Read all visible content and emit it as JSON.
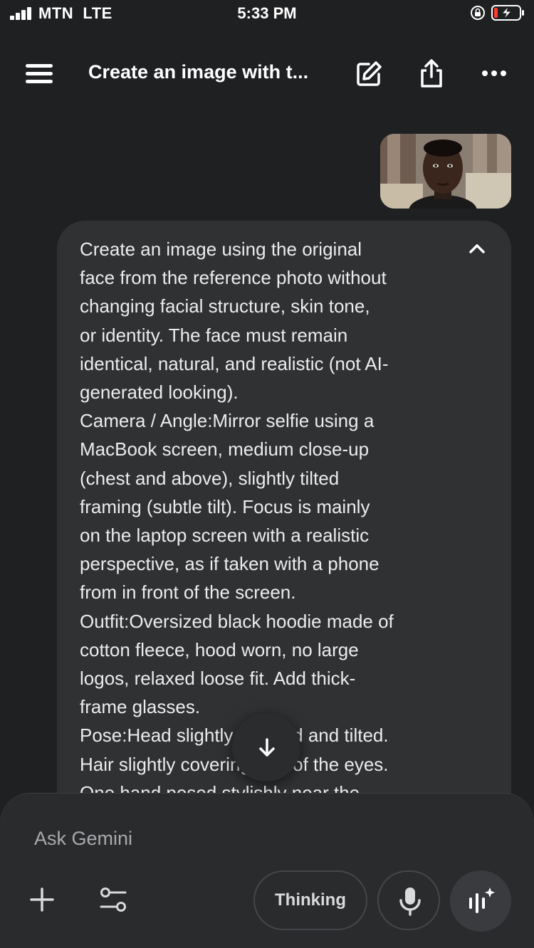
{
  "status_bar": {
    "carrier": "MTN",
    "network": "LTE",
    "time": "5:33 PM"
  },
  "header": {
    "title": "Create an image with t..."
  },
  "icons": {
    "menu": "hamburger-menu-icon",
    "new_chat": "edit-icon",
    "share": "share-icon",
    "more": "more-icon",
    "collapse": "chevron-up-icon",
    "scroll_down": "arrow-down-icon",
    "add": "plus-icon",
    "tools": "tools-icon",
    "mic": "microphone-icon",
    "live": "live-voice-icon"
  },
  "message": {
    "text": "Create an image using the original\nface from the reference photo without\nchanging facial structure, skin tone,\nor identity. The face must remain\nidentical, natural, and realistic (not AI-\ngenerated looking).\nCamera / Angle:Mirror selfie using a\nMacBook screen, medium close-up\n(chest and above), slightly tilted\nframing (subtle tilt). Focus is mainly\non the laptop screen with a realistic\nperspective, as if taken with a phone\nfrom in front of the screen.\nOutfit:Oversized black hoodie made of\ncotton fleece, hood worn, no large\nlogos, relaxed loose fit. Add thick-\nframe glasses.\nPose:Head slightly lowered and tilted.\nHair slightly covering part of the eyes.\nOne hand posed stylishly near the"
  },
  "composer": {
    "placeholder": "Ask Gemini",
    "mode_label": "Thinking"
  },
  "colors": {
    "background": "#1f2022",
    "bubble": "#2f3133",
    "panel": "#2a2b2d",
    "battery_low": "#ff3b30"
  }
}
